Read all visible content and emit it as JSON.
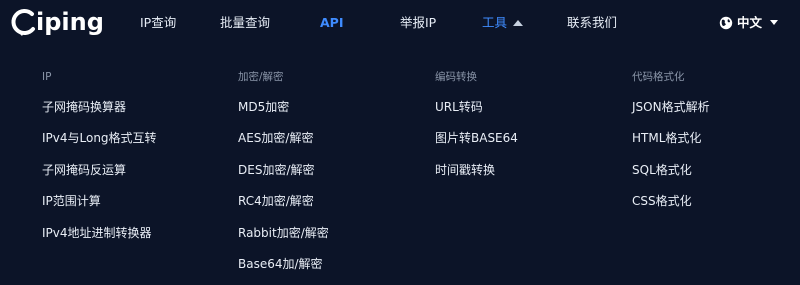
{
  "brand": {
    "name": "iping"
  },
  "nav": {
    "items": [
      {
        "label": "IP查询"
      },
      {
        "label": "批量查询"
      },
      {
        "label": "API"
      },
      {
        "label": "举报IP"
      },
      {
        "label": "工具"
      },
      {
        "label": "联系我们"
      }
    ],
    "active_color": "#3f8cff"
  },
  "language": {
    "label": "中文",
    "icon": "globe-icon"
  },
  "menu": {
    "columns": [
      {
        "heading": "IP",
        "links": [
          "子网掩码换算器",
          "IPv4与Long格式互转",
          "子网掩码反运算",
          "IP范围计算",
          "IPv4地址进制转换器"
        ]
      },
      {
        "heading": "加密/解密",
        "links": [
          "MD5加密",
          "AES加密/解密",
          "DES加密/解密",
          "RC4加密/解密",
          "Rabbit加密/解密",
          "Base64加/解密"
        ]
      },
      {
        "heading": "编码转换",
        "links": [
          "URL转码",
          "图片转BASE64",
          "时间戳转换"
        ]
      },
      {
        "heading": "代码格式化",
        "links": [
          "JSON格式解析",
          "HTML格式化",
          "SQL格式化",
          "CSS格式化"
        ]
      }
    ]
  },
  "colors": {
    "background": "#0c1428",
    "accent": "#3f8cff",
    "muted": "#8a95a8"
  }
}
